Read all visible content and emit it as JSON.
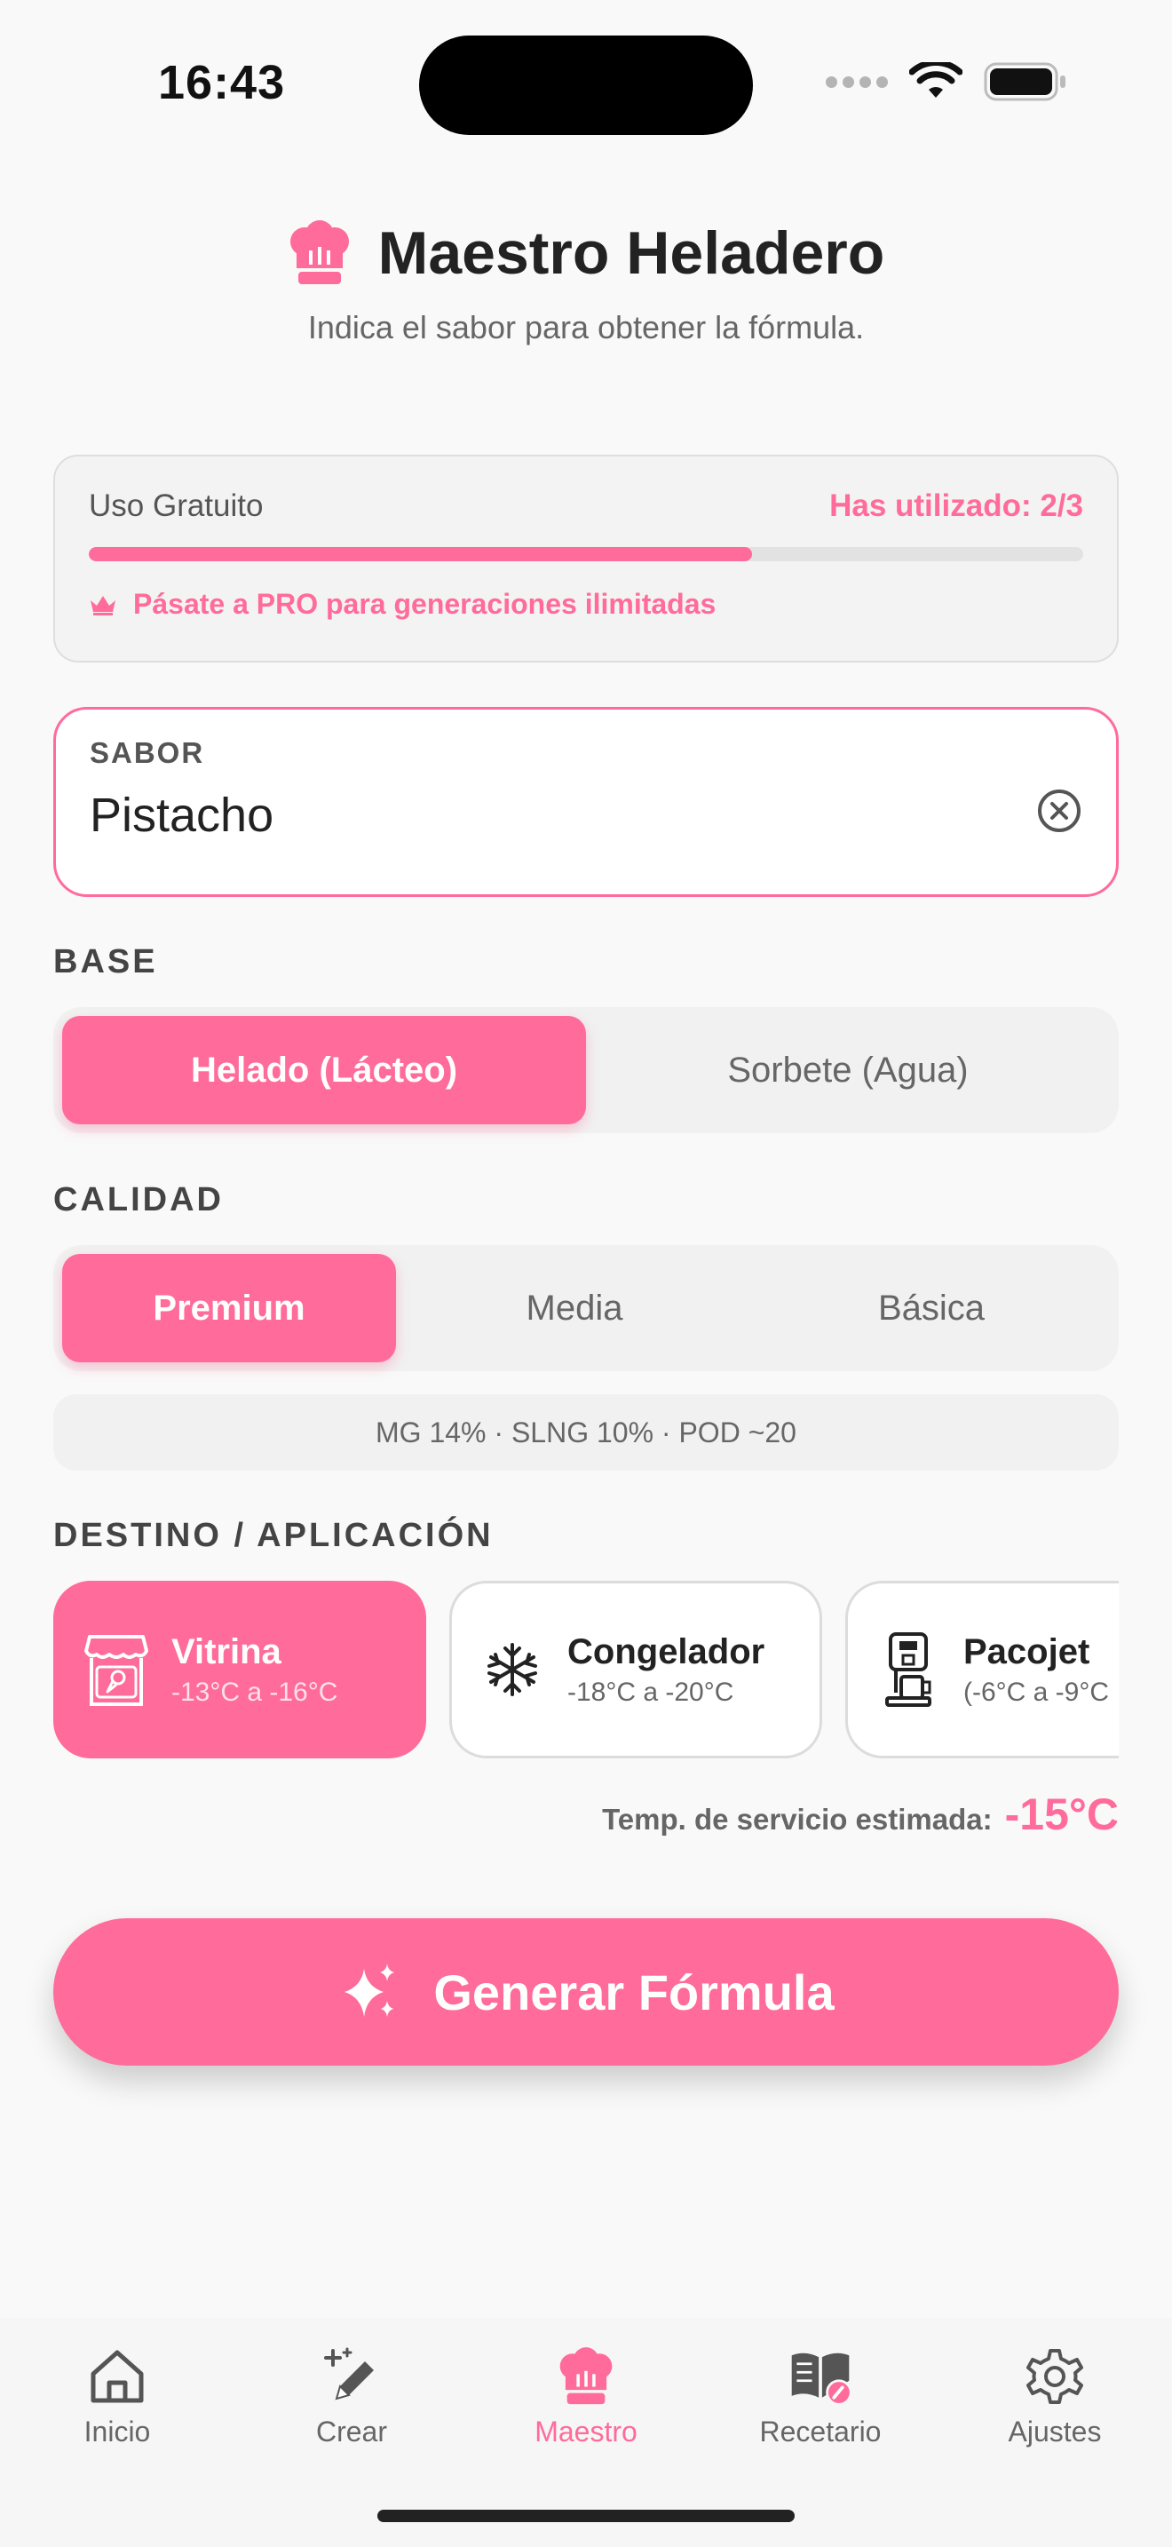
{
  "status_bar": {
    "time": "16:43"
  },
  "header": {
    "title": "Maestro Heladero",
    "subtitle": "Indica el sabor para obtener la fórmula."
  },
  "usage": {
    "label": "Uso Gratuito",
    "count_text": "Has utilizado: 2/3",
    "progress": 0.667,
    "pro_text": "Pásate a PRO para generaciones ilimitadas"
  },
  "flavor": {
    "label": "SABOR",
    "value": "Pistacho"
  },
  "base": {
    "label": "BASE",
    "options": [
      {
        "label": "Helado (Lácteo)",
        "selected": true
      },
      {
        "label": "Sorbete (Agua)",
        "selected": false
      }
    ]
  },
  "quality": {
    "label": "CALIDAD",
    "options": [
      {
        "label": "Premium",
        "selected": true
      },
      {
        "label": "Media",
        "selected": false
      },
      {
        "label": "Básica",
        "selected": false
      }
    ],
    "info": "MG 14% · SLNG 10% · POD ~20"
  },
  "destination": {
    "label": "DESTINO / APLICACIÓN",
    "options": [
      {
        "name": "Vitrina",
        "temp": "-13°C a -16°C",
        "icon": "display-case-icon",
        "selected": true
      },
      {
        "name": "Congelador",
        "temp": "-18°C a -20°C",
        "icon": "snowflake-icon",
        "selected": false
      },
      {
        "name": "Pacojet",
        "temp": "(-6°C a -9°C",
        "icon": "pacojet-machine-icon",
        "selected": false
      }
    ],
    "service_label": "Temp. de servicio estimada:",
    "service_value": "-15°C"
  },
  "generate_button": {
    "label": "Generar Fórmula",
    "icon": "sparkles-icon"
  },
  "tab_bar": {
    "items": [
      {
        "label": "Inicio",
        "icon": "home-icon",
        "active": false
      },
      {
        "label": "Crear",
        "icon": "magic-pencil-icon",
        "active": false
      },
      {
        "label": "Maestro",
        "icon": "chef-hat-icon",
        "active": true
      },
      {
        "label": "Recetario",
        "icon": "recipe-book-icon",
        "active": false
      },
      {
        "label": "Ajustes",
        "icon": "gear-icon",
        "active": false
      }
    ]
  },
  "colors": {
    "accent": "#ff6b9a",
    "background": "#f9f9f9",
    "text": "#222222"
  }
}
